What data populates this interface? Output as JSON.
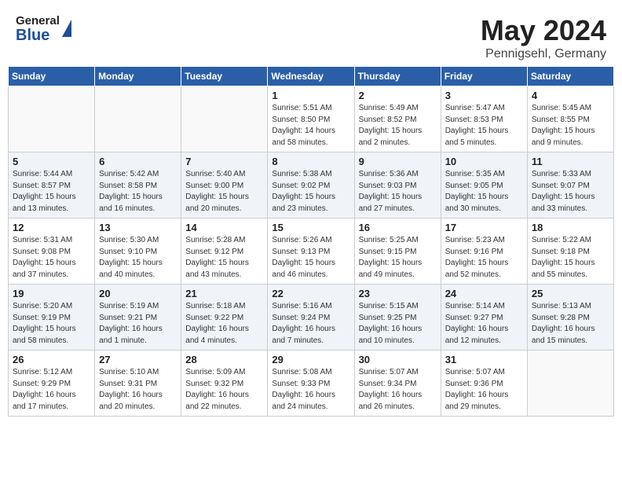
{
  "header": {
    "logo_general": "General",
    "logo_blue": "Blue",
    "month_title": "May 2024",
    "location": "Pennigsehl, Germany"
  },
  "weekdays": [
    "Sunday",
    "Monday",
    "Tuesday",
    "Wednesday",
    "Thursday",
    "Friday",
    "Saturday"
  ],
  "weeks": [
    [
      {
        "day": "",
        "info": ""
      },
      {
        "day": "",
        "info": ""
      },
      {
        "day": "",
        "info": ""
      },
      {
        "day": "1",
        "info": "Sunrise: 5:51 AM\nSunset: 8:50 PM\nDaylight: 14 hours\nand 58 minutes."
      },
      {
        "day": "2",
        "info": "Sunrise: 5:49 AM\nSunset: 8:52 PM\nDaylight: 15 hours\nand 2 minutes."
      },
      {
        "day": "3",
        "info": "Sunrise: 5:47 AM\nSunset: 8:53 PM\nDaylight: 15 hours\nand 5 minutes."
      },
      {
        "day": "4",
        "info": "Sunrise: 5:45 AM\nSunset: 8:55 PM\nDaylight: 15 hours\nand 9 minutes."
      }
    ],
    [
      {
        "day": "5",
        "info": "Sunrise: 5:44 AM\nSunset: 8:57 PM\nDaylight: 15 hours\nand 13 minutes."
      },
      {
        "day": "6",
        "info": "Sunrise: 5:42 AM\nSunset: 8:58 PM\nDaylight: 15 hours\nand 16 minutes."
      },
      {
        "day": "7",
        "info": "Sunrise: 5:40 AM\nSunset: 9:00 PM\nDaylight: 15 hours\nand 20 minutes."
      },
      {
        "day": "8",
        "info": "Sunrise: 5:38 AM\nSunset: 9:02 PM\nDaylight: 15 hours\nand 23 minutes."
      },
      {
        "day": "9",
        "info": "Sunrise: 5:36 AM\nSunset: 9:03 PM\nDaylight: 15 hours\nand 27 minutes."
      },
      {
        "day": "10",
        "info": "Sunrise: 5:35 AM\nSunset: 9:05 PM\nDaylight: 15 hours\nand 30 minutes."
      },
      {
        "day": "11",
        "info": "Sunrise: 5:33 AM\nSunset: 9:07 PM\nDaylight: 15 hours\nand 33 minutes."
      }
    ],
    [
      {
        "day": "12",
        "info": "Sunrise: 5:31 AM\nSunset: 9:08 PM\nDaylight: 15 hours\nand 37 minutes."
      },
      {
        "day": "13",
        "info": "Sunrise: 5:30 AM\nSunset: 9:10 PM\nDaylight: 15 hours\nand 40 minutes."
      },
      {
        "day": "14",
        "info": "Sunrise: 5:28 AM\nSunset: 9:12 PM\nDaylight: 15 hours\nand 43 minutes."
      },
      {
        "day": "15",
        "info": "Sunrise: 5:26 AM\nSunset: 9:13 PM\nDaylight: 15 hours\nand 46 minutes."
      },
      {
        "day": "16",
        "info": "Sunrise: 5:25 AM\nSunset: 9:15 PM\nDaylight: 15 hours\nand 49 minutes."
      },
      {
        "day": "17",
        "info": "Sunrise: 5:23 AM\nSunset: 9:16 PM\nDaylight: 15 hours\nand 52 minutes."
      },
      {
        "day": "18",
        "info": "Sunrise: 5:22 AM\nSunset: 9:18 PM\nDaylight: 15 hours\nand 55 minutes."
      }
    ],
    [
      {
        "day": "19",
        "info": "Sunrise: 5:20 AM\nSunset: 9:19 PM\nDaylight: 15 hours\nand 58 minutes."
      },
      {
        "day": "20",
        "info": "Sunrise: 5:19 AM\nSunset: 9:21 PM\nDaylight: 16 hours\nand 1 minute."
      },
      {
        "day": "21",
        "info": "Sunrise: 5:18 AM\nSunset: 9:22 PM\nDaylight: 16 hours\nand 4 minutes."
      },
      {
        "day": "22",
        "info": "Sunrise: 5:16 AM\nSunset: 9:24 PM\nDaylight: 16 hours\nand 7 minutes."
      },
      {
        "day": "23",
        "info": "Sunrise: 5:15 AM\nSunset: 9:25 PM\nDaylight: 16 hours\nand 10 minutes."
      },
      {
        "day": "24",
        "info": "Sunrise: 5:14 AM\nSunset: 9:27 PM\nDaylight: 16 hours\nand 12 minutes."
      },
      {
        "day": "25",
        "info": "Sunrise: 5:13 AM\nSunset: 9:28 PM\nDaylight: 16 hours\nand 15 minutes."
      }
    ],
    [
      {
        "day": "26",
        "info": "Sunrise: 5:12 AM\nSunset: 9:29 PM\nDaylight: 16 hours\nand 17 minutes."
      },
      {
        "day": "27",
        "info": "Sunrise: 5:10 AM\nSunset: 9:31 PM\nDaylight: 16 hours\nand 20 minutes."
      },
      {
        "day": "28",
        "info": "Sunrise: 5:09 AM\nSunset: 9:32 PM\nDaylight: 16 hours\nand 22 minutes."
      },
      {
        "day": "29",
        "info": "Sunrise: 5:08 AM\nSunset: 9:33 PM\nDaylight: 16 hours\nand 24 minutes."
      },
      {
        "day": "30",
        "info": "Sunrise: 5:07 AM\nSunset: 9:34 PM\nDaylight: 16 hours\nand 26 minutes."
      },
      {
        "day": "31",
        "info": "Sunrise: 5:07 AM\nSunset: 9:36 PM\nDaylight: 16 hours\nand 29 minutes."
      },
      {
        "day": "",
        "info": ""
      }
    ]
  ]
}
